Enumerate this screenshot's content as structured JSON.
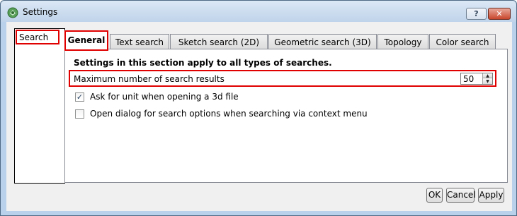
{
  "window": {
    "title": "Settings",
    "help_label": "?",
    "close_label": "✕"
  },
  "nav": {
    "items": [
      {
        "label": "Search",
        "selected": true
      }
    ]
  },
  "tabs": [
    {
      "label": "General",
      "active": true
    },
    {
      "label": "Text search",
      "active": false
    },
    {
      "label": "Sketch search (2D)",
      "active": false
    },
    {
      "label": "Geometric search (3D)",
      "active": false
    },
    {
      "label": "Topology",
      "active": false
    },
    {
      "label": "Color search",
      "active": false
    }
  ],
  "general": {
    "heading": "Settings in this section apply to all types of searches.",
    "max_results_label": "Maximum number of search results",
    "max_results_value": "50",
    "options": [
      {
        "label": "Ask for unit when opening a 3d file",
        "checked": true
      },
      {
        "label": "Open dialog for search options when searching via context menu",
        "checked": false
      }
    ]
  },
  "buttons": {
    "ok": "OK",
    "cancel": "Cancel",
    "apply": "Apply"
  },
  "colors": {
    "highlight": "#e00000",
    "titlebar": "#bfd3ea",
    "dialog_background": "#f0f0f0"
  }
}
